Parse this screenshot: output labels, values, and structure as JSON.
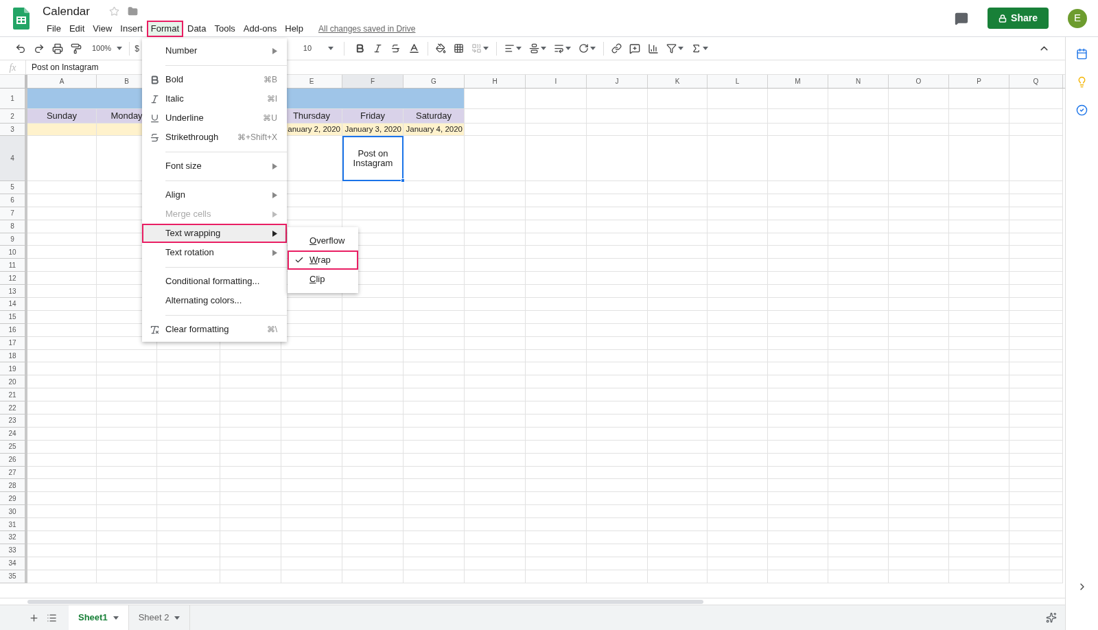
{
  "title": "Calendar",
  "menu_bar": [
    {
      "label": "File",
      "selected": false
    },
    {
      "label": "Edit",
      "selected": false
    },
    {
      "label": "View",
      "selected": false
    },
    {
      "label": "Insert",
      "selected": false
    },
    {
      "label": "Format",
      "selected": true
    },
    {
      "label": "Data",
      "selected": false
    },
    {
      "label": "Tools",
      "selected": false
    },
    {
      "label": "Add-ons",
      "selected": false
    },
    {
      "label": "Help",
      "selected": false
    }
  ],
  "save_status": "All changes saved in Drive",
  "share_button": "Share",
  "avatar": "E",
  "toolbar": {
    "zoom": "100%",
    "currency": "$",
    "font_size": "10"
  },
  "formula_bar": {
    "fx": "fx",
    "value": "Post on Instagram"
  },
  "columns": [
    {
      "label": "A",
      "selected": false
    },
    {
      "label": "B",
      "selected": false
    },
    {
      "label": "E",
      "selected": false
    },
    {
      "label": "F",
      "selected": true
    },
    {
      "label": "G",
      "selected": false
    },
    {
      "label": "H",
      "selected": false
    },
    {
      "label": "I",
      "selected": false
    },
    {
      "label": "J",
      "selected": false
    },
    {
      "label": "K",
      "selected": false
    },
    {
      "label": "L",
      "selected": false
    },
    {
      "label": "M",
      "selected": false
    },
    {
      "label": "N",
      "selected": false
    },
    {
      "label": "O",
      "selected": false
    },
    {
      "label": "P",
      "selected": false
    },
    {
      "label": "Q",
      "selected": false
    }
  ],
  "rows": [
    {
      "number": "1",
      "selected": false,
      "kind": "banner",
      "cells": []
    },
    {
      "number": "2",
      "selected": false,
      "kind": "days",
      "cells": [
        {
          "text": "Sunday"
        },
        {
          "text": "Monday"
        },
        null,
        null,
        {
          "text": "Thursday"
        },
        {
          "text": "Friday"
        },
        {
          "text": "Saturday"
        }
      ]
    },
    {
      "number": "3",
      "selected": false,
      "kind": "dates",
      "cells": [
        null,
        null,
        null,
        null,
        {
          "text": "anuary 2, 2020"
        },
        {
          "text": "January 3, 2020"
        },
        {
          "text": "January 4, 2020"
        }
      ]
    },
    {
      "number": "4",
      "selected": true,
      "kind": "plain",
      "cells": [
        null,
        null,
        null,
        null,
        null,
        {
          "text": "Post on Instagram",
          "selected": true
        }
      ]
    },
    {
      "number": "5",
      "selected": false,
      "kind": "plain",
      "cells": []
    },
    {
      "number": "6",
      "selected": false,
      "kind": "plain",
      "cells": []
    },
    {
      "number": "7",
      "selected": false,
      "kind": "plain",
      "cells": []
    },
    {
      "number": "8",
      "selected": false,
      "kind": "plain",
      "cells": []
    },
    {
      "number": "9",
      "selected": false,
      "kind": "plain",
      "cells": []
    },
    {
      "number": "10",
      "selected": false,
      "kind": "plain",
      "cells": []
    },
    {
      "number": "11",
      "selected": false,
      "kind": "plain",
      "cells": []
    },
    {
      "number": "12",
      "selected": false,
      "kind": "plain",
      "cells": []
    },
    {
      "number": "13",
      "selected": false,
      "kind": "plain",
      "cells": []
    },
    {
      "number": "14",
      "selected": false,
      "kind": "plain",
      "cells": []
    },
    {
      "number": "15",
      "selected": false,
      "kind": "plain",
      "cells": []
    },
    {
      "number": "16",
      "selected": false,
      "kind": "plain",
      "cells": []
    },
    {
      "number": "17",
      "selected": false,
      "kind": "plain",
      "cells": []
    },
    {
      "number": "18",
      "selected": false,
      "kind": "plain",
      "cells": []
    },
    {
      "number": "19",
      "selected": false,
      "kind": "plain",
      "cells": []
    },
    {
      "number": "20",
      "selected": false,
      "kind": "plain",
      "cells": []
    },
    {
      "number": "21",
      "selected": false,
      "kind": "plain",
      "cells": []
    },
    {
      "number": "22",
      "selected": false,
      "kind": "plain",
      "cells": []
    },
    {
      "number": "23",
      "selected": false,
      "kind": "plain",
      "cells": []
    },
    {
      "number": "24",
      "selected": false,
      "kind": "plain",
      "cells": []
    },
    {
      "number": "25",
      "selected": false,
      "kind": "plain",
      "cells": []
    },
    {
      "number": "26",
      "selected": false,
      "kind": "plain",
      "cells": []
    },
    {
      "number": "27",
      "selected": false,
      "kind": "plain",
      "cells": []
    },
    {
      "number": "28",
      "selected": false,
      "kind": "plain",
      "cells": []
    },
    {
      "number": "29",
      "selected": false,
      "kind": "plain",
      "cells": []
    },
    {
      "number": "30",
      "selected": false,
      "kind": "plain",
      "cells": []
    },
    {
      "number": "31",
      "selected": false,
      "kind": "plain",
      "cells": []
    },
    {
      "number": "32",
      "selected": false,
      "kind": "plain",
      "cells": []
    },
    {
      "number": "33",
      "selected": false,
      "kind": "plain",
      "cells": []
    },
    {
      "number": "34",
      "selected": false,
      "kind": "plain",
      "cells": []
    },
    {
      "number": "35",
      "selected": false,
      "kind": "plain",
      "cells": []
    }
  ],
  "format_menu": [
    {
      "kind": "submenu",
      "label": "Number",
      "disabled": false,
      "selected": false
    },
    {
      "kind": "separator"
    },
    {
      "kind": "command",
      "label": "Bold",
      "shortcut": "⌘B",
      "disabled": false,
      "selected": false
    },
    {
      "kind": "command",
      "label": "Italic",
      "shortcut": "⌘I",
      "disabled": false,
      "selected": false
    },
    {
      "kind": "command",
      "label": "Underline",
      "shortcut": "⌘U",
      "disabled": false,
      "selected": false
    },
    {
      "kind": "command",
      "label": "Strikethrough",
      "shortcut": "⌘+Shift+X",
      "disabled": false,
      "selected": false
    },
    {
      "kind": "separator"
    },
    {
      "kind": "submenu",
      "label": "Font size",
      "disabled": false,
      "selected": false
    },
    {
      "kind": "separator"
    },
    {
      "kind": "submenu",
      "label": "Align",
      "disabled": false,
      "selected": false
    },
    {
      "kind": "submenu",
      "label": "Merge cells",
      "disabled": true,
      "selected": false
    },
    {
      "kind": "submenu",
      "label": "Text wrapping",
      "disabled": false,
      "selected": true
    },
    {
      "kind": "submenu",
      "label": "Text rotation",
      "disabled": false,
      "selected": false
    },
    {
      "kind": "separator"
    },
    {
      "kind": "command",
      "label": "Conditional formatting...",
      "disabled": false,
      "selected": false
    },
    {
      "kind": "command",
      "label": "Alternating colors...",
      "disabled": false,
      "selected": false
    },
    {
      "kind": "separator"
    },
    {
      "kind": "command",
      "label": "Clear formatting",
      "shortcut": "⌘\\",
      "disabled": false,
      "selected": false
    }
  ],
  "wrap_submenu": [
    {
      "label": "Overflow",
      "checked": false,
      "selected": false
    },
    {
      "label": "Wrap",
      "checked": true,
      "selected": true
    },
    {
      "label": "Clip",
      "checked": false,
      "selected": false
    }
  ],
  "sheet_tabs": [
    {
      "label": "Sheet1",
      "selected": true
    },
    {
      "label": "Sheet 2",
      "selected": false
    }
  ]
}
